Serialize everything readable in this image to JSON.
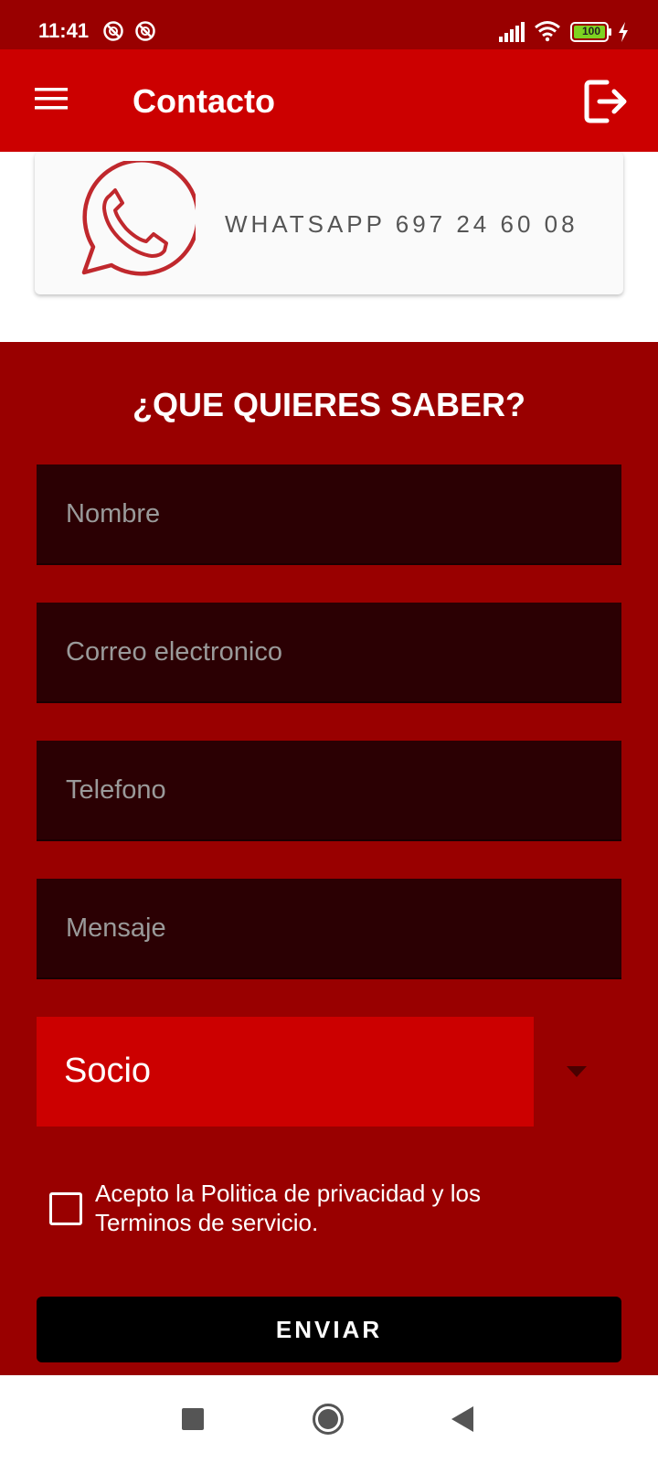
{
  "status_bar": {
    "time": "11:41",
    "battery_level": "100",
    "icons": [
      "notification-icon",
      "notification-icon",
      "signal-icon",
      "wifi-icon",
      "battery-icon",
      "charging-icon"
    ]
  },
  "app_bar": {
    "title": "Contacto",
    "menu_icon": "menu-icon",
    "action_icon": "logout-icon"
  },
  "whatsapp_card": {
    "icon": "whatsapp-icon",
    "label": "WHATSAPP 697 24 60 08"
  },
  "form": {
    "title": "¿QUE QUIERES SABER?",
    "fields": {
      "nombre_placeholder": "Nombre",
      "correo_placeholder": "Correo electronico",
      "telefono_placeholder": "Telefono",
      "mensaje_placeholder": "Mensaje"
    },
    "select": {
      "value": "Socio"
    },
    "checkbox": {
      "checked": false,
      "label": "Acepto la Politica de privacidad y los Terminos de servicio."
    },
    "submit_label": "ENVIAR"
  },
  "colors": {
    "status_bar": "#990000",
    "app_bar": "#cc0000",
    "form_background": "#990000",
    "field_background": "#2b0003",
    "select_background": "#cc0000",
    "button_background": "#000000",
    "whatsapp_icon": "#c0282d"
  },
  "nav_bar": {
    "icons": [
      "recents-icon",
      "home-icon",
      "back-icon"
    ]
  }
}
